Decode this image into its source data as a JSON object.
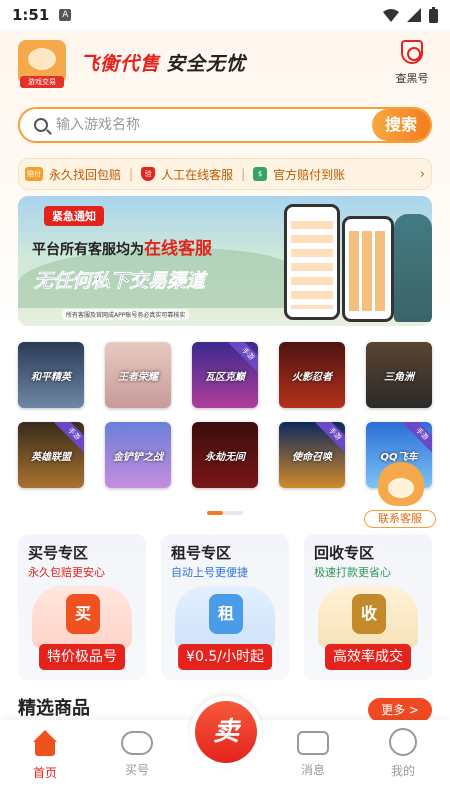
{
  "status_bar": {
    "time": "1:51",
    "sim_label": "A"
  },
  "header": {
    "logo_tag": "游戏交易",
    "brand_red": "飞衡代售",
    "brand_slogan": "安全无忧",
    "blacklist_label": "查黑号"
  },
  "search": {
    "placeholder": "输入游戏名称",
    "button_label": "搜索"
  },
  "guarantees": [
    {
      "badge": "赔付",
      "text": "永久找回包赔"
    },
    {
      "badge": "验",
      "text": "人工在线客服"
    },
    {
      "badge": "$",
      "text": "官方赔付到账"
    }
  ],
  "banner": {
    "notice": "紧急通知",
    "line1_prefix": "平台所有客服均为",
    "line1_highlight": "在线客服",
    "line2": "无任何私下交易渠道",
    "footnote": "所有客服及官网成APP账号务必真实可靠核实"
  },
  "games": [
    {
      "name": "和平精英",
      "mobile": false,
      "bg": "linear-gradient(#2b3b56,#6f87a6)"
    },
    {
      "name": "王者荣耀",
      "mobile": false,
      "bg": "linear-gradient(#e9c9c0,#c79b9b)"
    },
    {
      "name": "瓦区克巅",
      "mobile": true,
      "bg": "linear-gradient(#3b2a8c,#b03e9b)"
    },
    {
      "name": "火影忍者",
      "mobile": false,
      "bg": "linear-gradient(#4d1411,#b4321e)"
    },
    {
      "name": "三角洲",
      "mobile": false,
      "bg": "linear-gradient(#5a4532,#2b2a28)"
    },
    {
      "name": "英雄联盟",
      "mobile": true,
      "bg": "linear-gradient(#3a2c1c,#a8722e)"
    },
    {
      "name": "金铲铲之战",
      "mobile": false,
      "bg": "linear-gradient(#6b7fd8,#c58ee0)"
    },
    {
      "name": "永劫无间",
      "mobile": false,
      "bg": "linear-gradient(#3c0d0d,#7a1616)"
    },
    {
      "name": "使命召唤",
      "mobile": true,
      "bg": "linear-gradient(#0d2a5c,#d18a2b)"
    },
    {
      "name": "QQ飞车",
      "mobile": true,
      "bg": "linear-gradient(#2b6fd6,#7ec3f5)"
    }
  ],
  "game_badge": "手游",
  "contact_service": "联系客服",
  "zones": [
    {
      "title": "买号专区",
      "subtitle": "永久包赔更安心",
      "sub_color": "#e4231d",
      "icon": "买",
      "icon_color": "#f0521f",
      "art_bg": "linear-gradient(#ffe7df,#ffd3c8)",
      "tag": "特价极品号"
    },
    {
      "title": "租号专区",
      "subtitle": "自动上号更便捷",
      "sub_color": "#2f73d8",
      "icon": "租",
      "icon_color": "#4a9be8",
      "art_bg": "linear-gradient(#e3f0ff,#cfe3fb)",
      "tag": "¥0.5/小时起"
    },
    {
      "title": "回收专区",
      "subtitle": "极速打款更省心",
      "sub_color": "#2f9a58",
      "icon": "收",
      "icon_color": "#c48a2a",
      "art_bg": "linear-gradient(#fff2d9,#f7e2b8)",
      "tag": "高效率成交"
    }
  ],
  "section": {
    "title": "精选商品",
    "more": "更多 >"
  },
  "tabbar": {
    "home": "首页",
    "buy": "买号",
    "sell": "卖",
    "messages": "消息",
    "mine": "我的"
  }
}
